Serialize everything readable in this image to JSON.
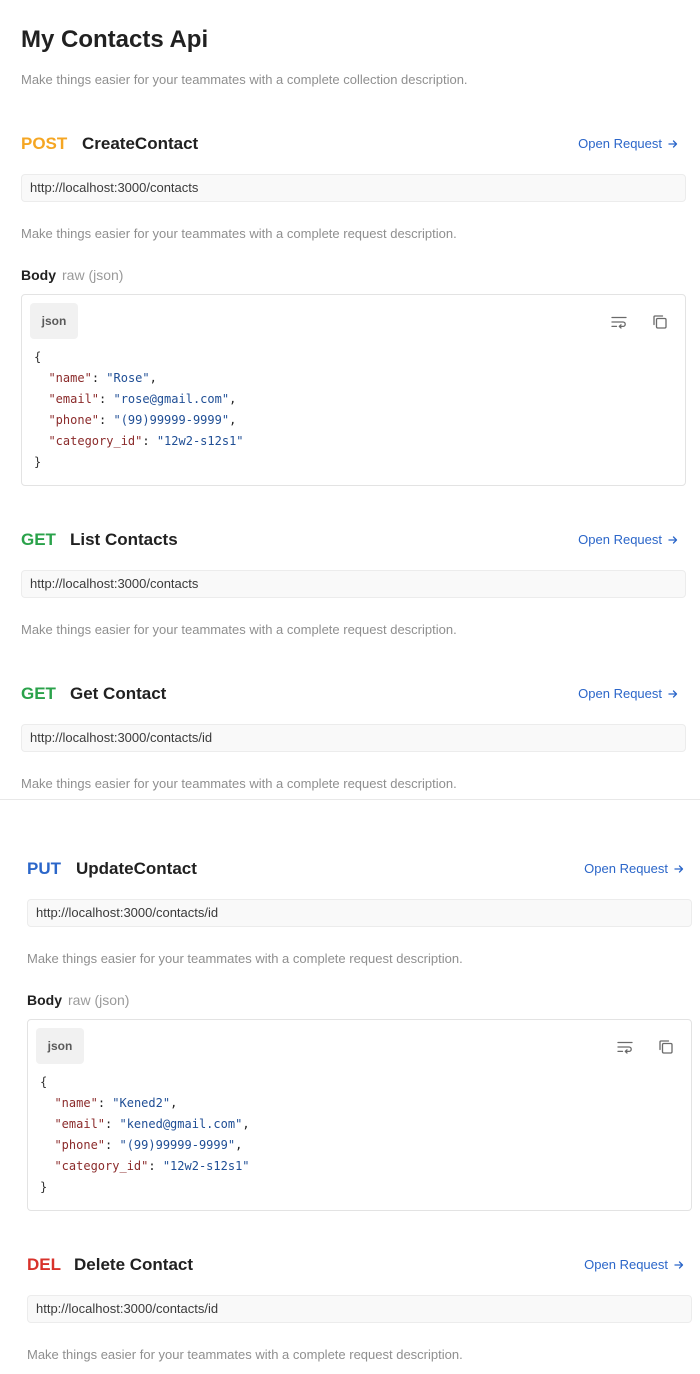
{
  "collection": {
    "title": "My Contacts Api",
    "description": "Make things easier for your teammates with a complete collection description."
  },
  "colors": {
    "post": "#f5a623",
    "get": "#2aa24a",
    "put": "#2b66c9",
    "del": "#d8322b",
    "link": "#2b66c9"
  },
  "icons": {
    "open": "arrow-right-icon",
    "wrap": "wrap-lines-icon",
    "copy": "copy-icon"
  },
  "common": {
    "open_request": "Open Request",
    "request_description": "Make things easier for your teammates with a complete request description.",
    "body_label": "Body",
    "body_mode": "raw (json)",
    "lang": "json"
  },
  "requests": [
    {
      "method": "POST",
      "name": "CreateContact",
      "url": "http://localhost:3000/contacts",
      "body": {
        "open": "{",
        "lines": [
          {
            "key": "\"name\"",
            "value": "\"Rose\"",
            "comma": ","
          },
          {
            "key": "\"email\"",
            "value": "\"rose@gmail.com\"",
            "comma": ","
          },
          {
            "key": "\"phone\"",
            "value": "\"(99)99999-9999\"",
            "comma": ","
          },
          {
            "key": "\"category_id\"",
            "value": "\"12w2-s12s1\"",
            "comma": ""
          }
        ],
        "close": "}"
      }
    },
    {
      "method": "GET",
      "name": "List Contacts",
      "url": "http://localhost:3000/contacts"
    },
    {
      "method": "GET",
      "name": "Get Contact",
      "url": "http://localhost:3000/contacts/id"
    },
    {
      "method": "PUT",
      "name": "UpdateContact",
      "url": "http://localhost:3000/contacts/id",
      "body": {
        "open": "{",
        "lines": [
          {
            "key": "\"name\"",
            "value": "\"Kened2\"",
            "comma": ","
          },
          {
            "key": "\"email\"",
            "value": "\"kened@gmail.com\"",
            "comma": ","
          },
          {
            "key": "\"phone\"",
            "value": "\"(99)99999-9999\"",
            "comma": ","
          },
          {
            "key": "\"category_id\"",
            "value": "\"12w2-s12s1\"",
            "comma": ""
          }
        ],
        "close": "}"
      }
    },
    {
      "method": "DEL",
      "name": "Delete Contact",
      "url": "http://localhost:3000/contacts/id"
    }
  ]
}
